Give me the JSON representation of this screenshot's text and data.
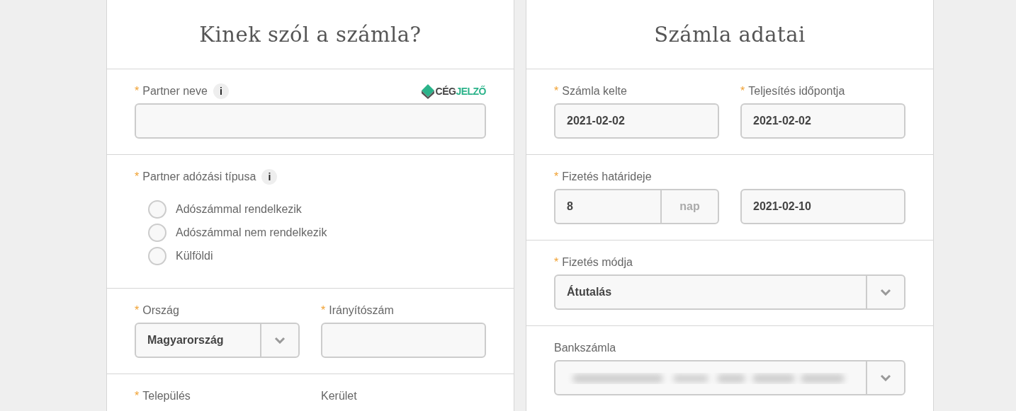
{
  "panels": [
    {
      "title": "Kinek szól a számla?",
      "sections": [
        {
          "fields": [
            {
              "kind": "text",
              "label": "Partner neve",
              "required_mark": "*",
              "info": "i",
              "logo": [
                "CÉG",
                "JELZŐ"
              ]
            }
          ]
        },
        {
          "fields": [
            {
              "kind": "radio",
              "label": "Partner adózási típusa",
              "required_mark": "*",
              "info": "i",
              "options": [
                {
                  "label": "Adószámmal rendelkezik",
                  "selected": false
                },
                {
                  "label": "Adószámmal nem rendelkezik",
                  "selected": false
                },
                {
                  "label": "Külföldi",
                  "selected": false
                }
              ]
            }
          ]
        },
        {
          "fields": [
            {
              "kind": "select",
              "label": "Ország",
              "required_mark": "*",
              "value": "Magyarország"
            },
            {
              "kind": "text",
              "label": "Irányítószám",
              "required_mark": "*"
            }
          ]
        },
        {
          "fields": [
            {
              "kind": "label",
              "label": "Település",
              "required_mark": "*"
            },
            {
              "kind": "label",
              "label": "Kerület"
            }
          ]
        }
      ]
    },
    {
      "title": "Számla adatai",
      "sections": [
        {
          "fields": [
            {
              "kind": "text",
              "label": "Számla kelte",
              "required_mark": "*",
              "value": "2021-02-02"
            },
            {
              "kind": "text",
              "label": "Teljesítés időpontja",
              "required_mark": "*",
              "value": "2021-02-02"
            }
          ]
        },
        {
          "fields": [
            {
              "kind": "number_unit",
              "label": "Fizetés határideje",
              "required_mark": "*",
              "value": "8",
              "unit": "nap"
            },
            {
              "kind": "text",
              "value": "2021-02-10"
            }
          ]
        },
        {
          "fields": [
            {
              "kind": "select",
              "label": "Fizetés módja",
              "required_mark": "*",
              "value": "Átutalás"
            }
          ]
        },
        {
          "fields": [
            {
              "kind": "select",
              "label": "Bankszámla",
              "value_hidden": true
            }
          ]
        }
      ]
    }
  ]
}
